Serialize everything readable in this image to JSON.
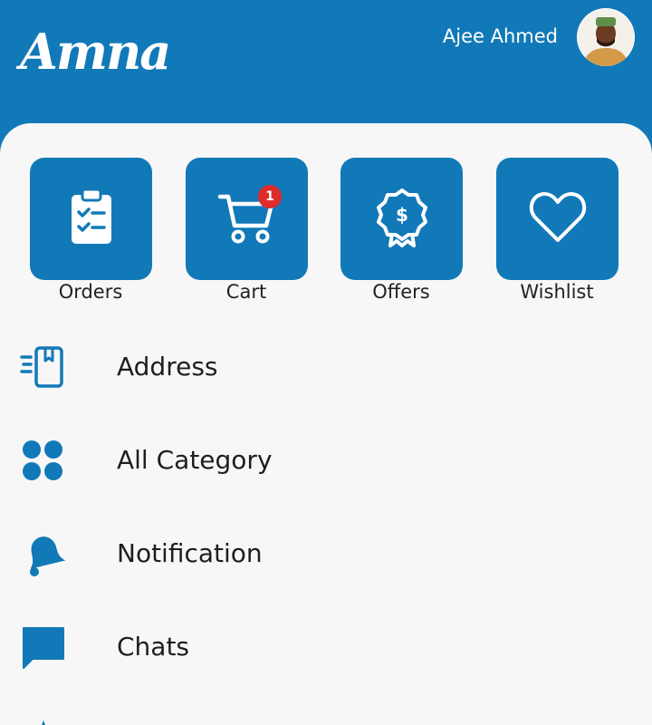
{
  "header": {
    "logo_text": "Amna",
    "user_name": "Ajee Ahmed"
  },
  "quick_actions": [
    {
      "label": "Orders",
      "icon": "clipboard-check-icon"
    },
    {
      "label": "Cart",
      "icon": "cart-icon",
      "badge": "1"
    },
    {
      "label": "Offers",
      "icon": "offer-badge-icon"
    },
    {
      "label": "Wishlist",
      "icon": "heart-icon"
    }
  ],
  "menu": [
    {
      "label": "Address",
      "icon": "address-icon"
    },
    {
      "label": "All Category",
      "icon": "category-grid-icon"
    },
    {
      "label": "Notification",
      "icon": "bell-icon"
    },
    {
      "label": "Chats",
      "icon": "chat-icon"
    }
  ],
  "colors": {
    "brand": "#1279b8",
    "badge": "#e02b2b",
    "panel": "#f7f7f7"
  }
}
